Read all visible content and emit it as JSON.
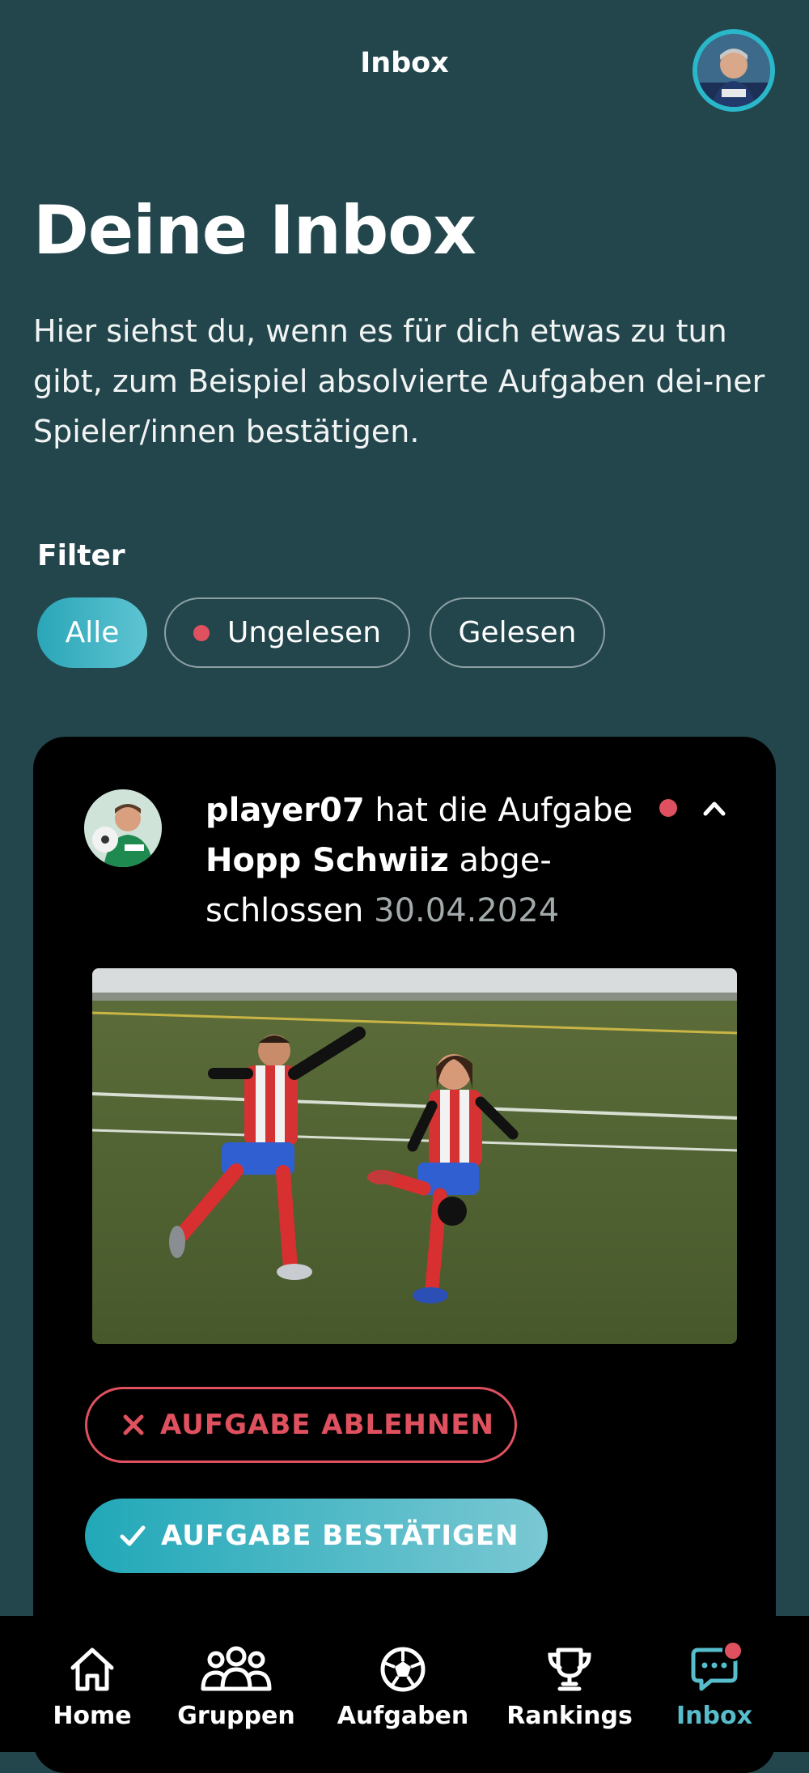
{
  "header": {
    "title": "Inbox"
  },
  "page": {
    "title": "Deine Inbox",
    "description": "Hier siehst du, wenn es für dich etwas zu tun gibt, zum Beispiel absolvierte Aufgaben dei-ner Spieler/innen bestätigen."
  },
  "filter": {
    "label": "Filter",
    "options": [
      "Alle",
      "Ungelesen",
      "Gelesen"
    ],
    "selected": "Alle"
  },
  "notification": {
    "player": "player07",
    "text_a": " hat die Aufgabe ",
    "task": "Hopp Schwiiz",
    "text_b": " abge-schlossen ",
    "date": "30.04.2024",
    "unread": true,
    "reject_label": "AUFGABE ABLEHNEN",
    "confirm_label": "AUFGABE BESTÄTIGEN"
  },
  "nav": {
    "items": [
      {
        "label": "Home",
        "icon": "house-icon"
      },
      {
        "label": "Gruppen",
        "icon": "group-icon"
      },
      {
        "label": "Aufgaben",
        "icon": "soccer-ball-icon"
      },
      {
        "label": "Rankings",
        "icon": "trophy-icon"
      },
      {
        "label": "Inbox",
        "icon": "chat-icon"
      }
    ],
    "active": "Inbox"
  },
  "colors": {
    "background": "#22464c",
    "accent": "#2ab7c9",
    "danger": "#e0515f",
    "card": "#000000"
  }
}
